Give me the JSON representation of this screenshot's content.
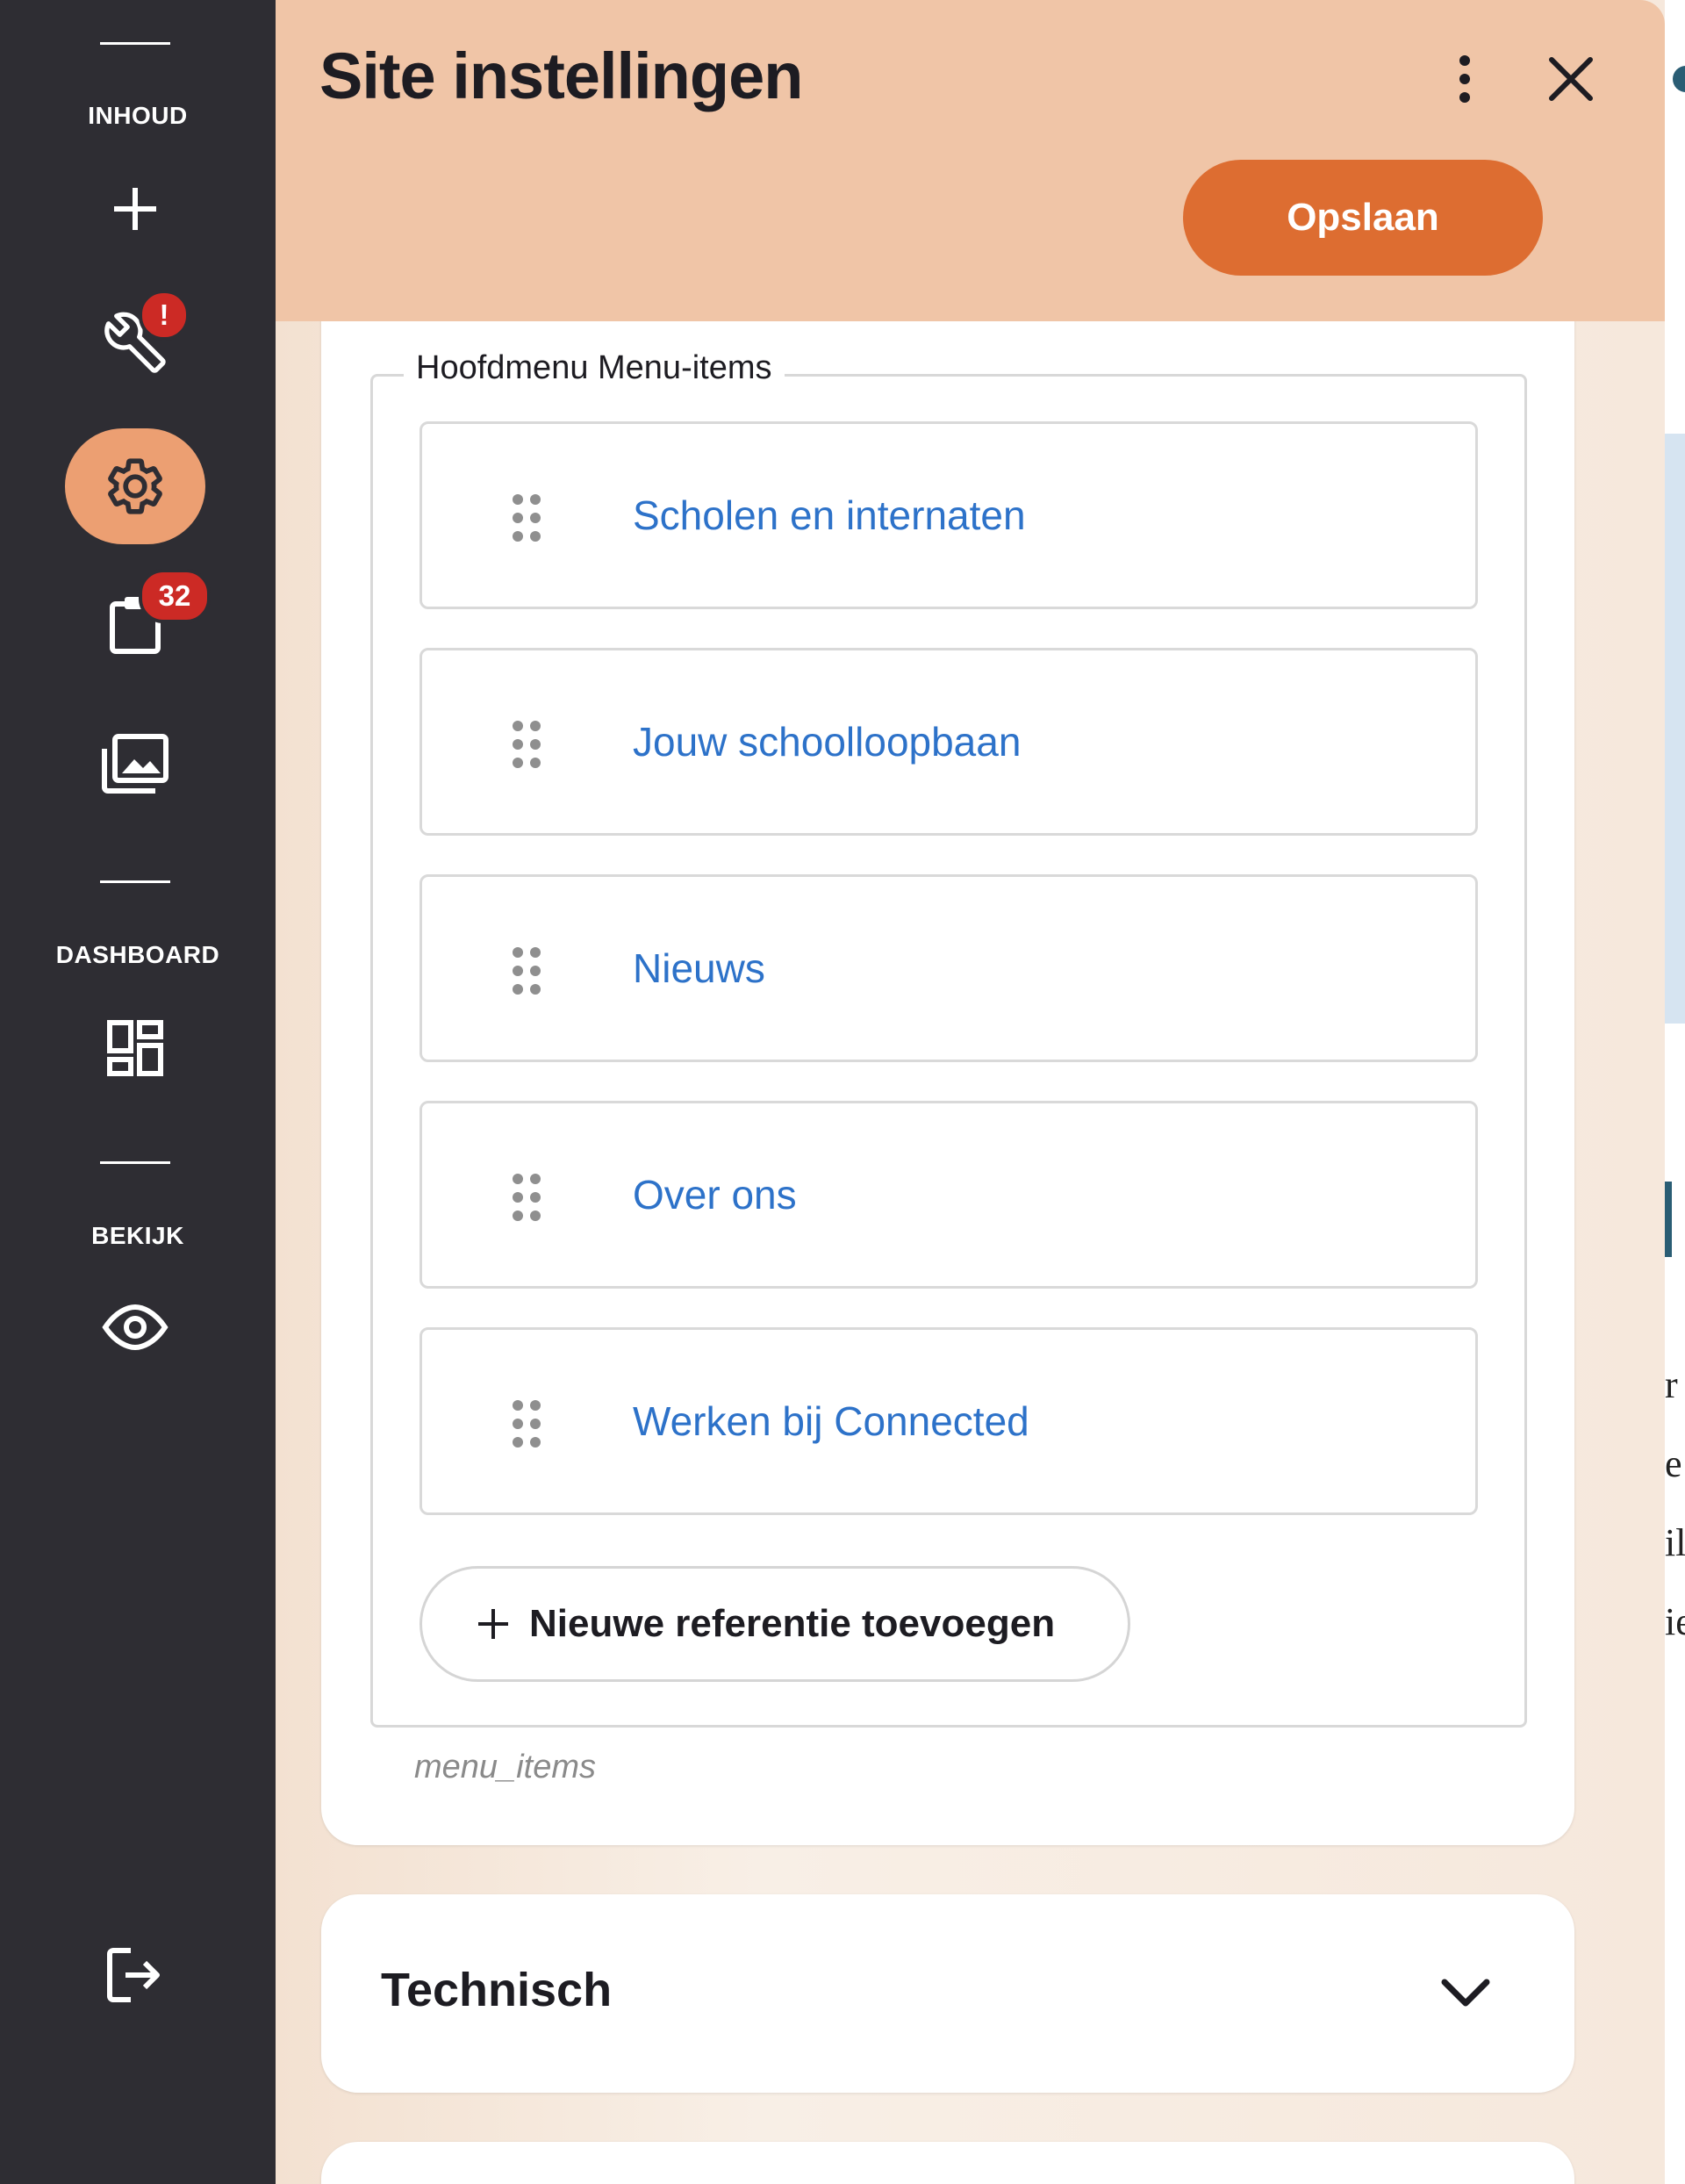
{
  "sidebar": {
    "sections": {
      "content": "INHOUD",
      "dashboard": "DASHBOARD",
      "view": "BEKIJK"
    },
    "badges": {
      "tools_alert": "!",
      "tasks_count": "32"
    },
    "icons": [
      "plus-icon",
      "wrench-icon",
      "gear-icon",
      "clipboard-icon",
      "media-library-icon",
      "dashboard-icon",
      "eye-icon",
      "logout-icon"
    ]
  },
  "panel": {
    "title": "Site instellingen",
    "save_label": "Opslaan",
    "fieldset_label": "Hoofdmenu Menu-items",
    "menu_items": [
      "Scholen en internaten",
      "Jouw schoolloopbaan",
      "Nieuws",
      "Over ons",
      "Werken bij Connected"
    ],
    "add_reference_label": "Nieuwe referentie toevoegen",
    "field_name": "menu_items",
    "collapsed_section": "Technisch"
  },
  "colors": {
    "rail": "#2e2d33",
    "header": "#f0c5a7",
    "accent": "#dd6d31",
    "active_nav": "#ec9f72",
    "link": "#2d72c9",
    "badge": "#cc2a25"
  },
  "background_page": {
    "chars": [
      "r",
      "e",
      "il",
      "ie"
    ]
  }
}
